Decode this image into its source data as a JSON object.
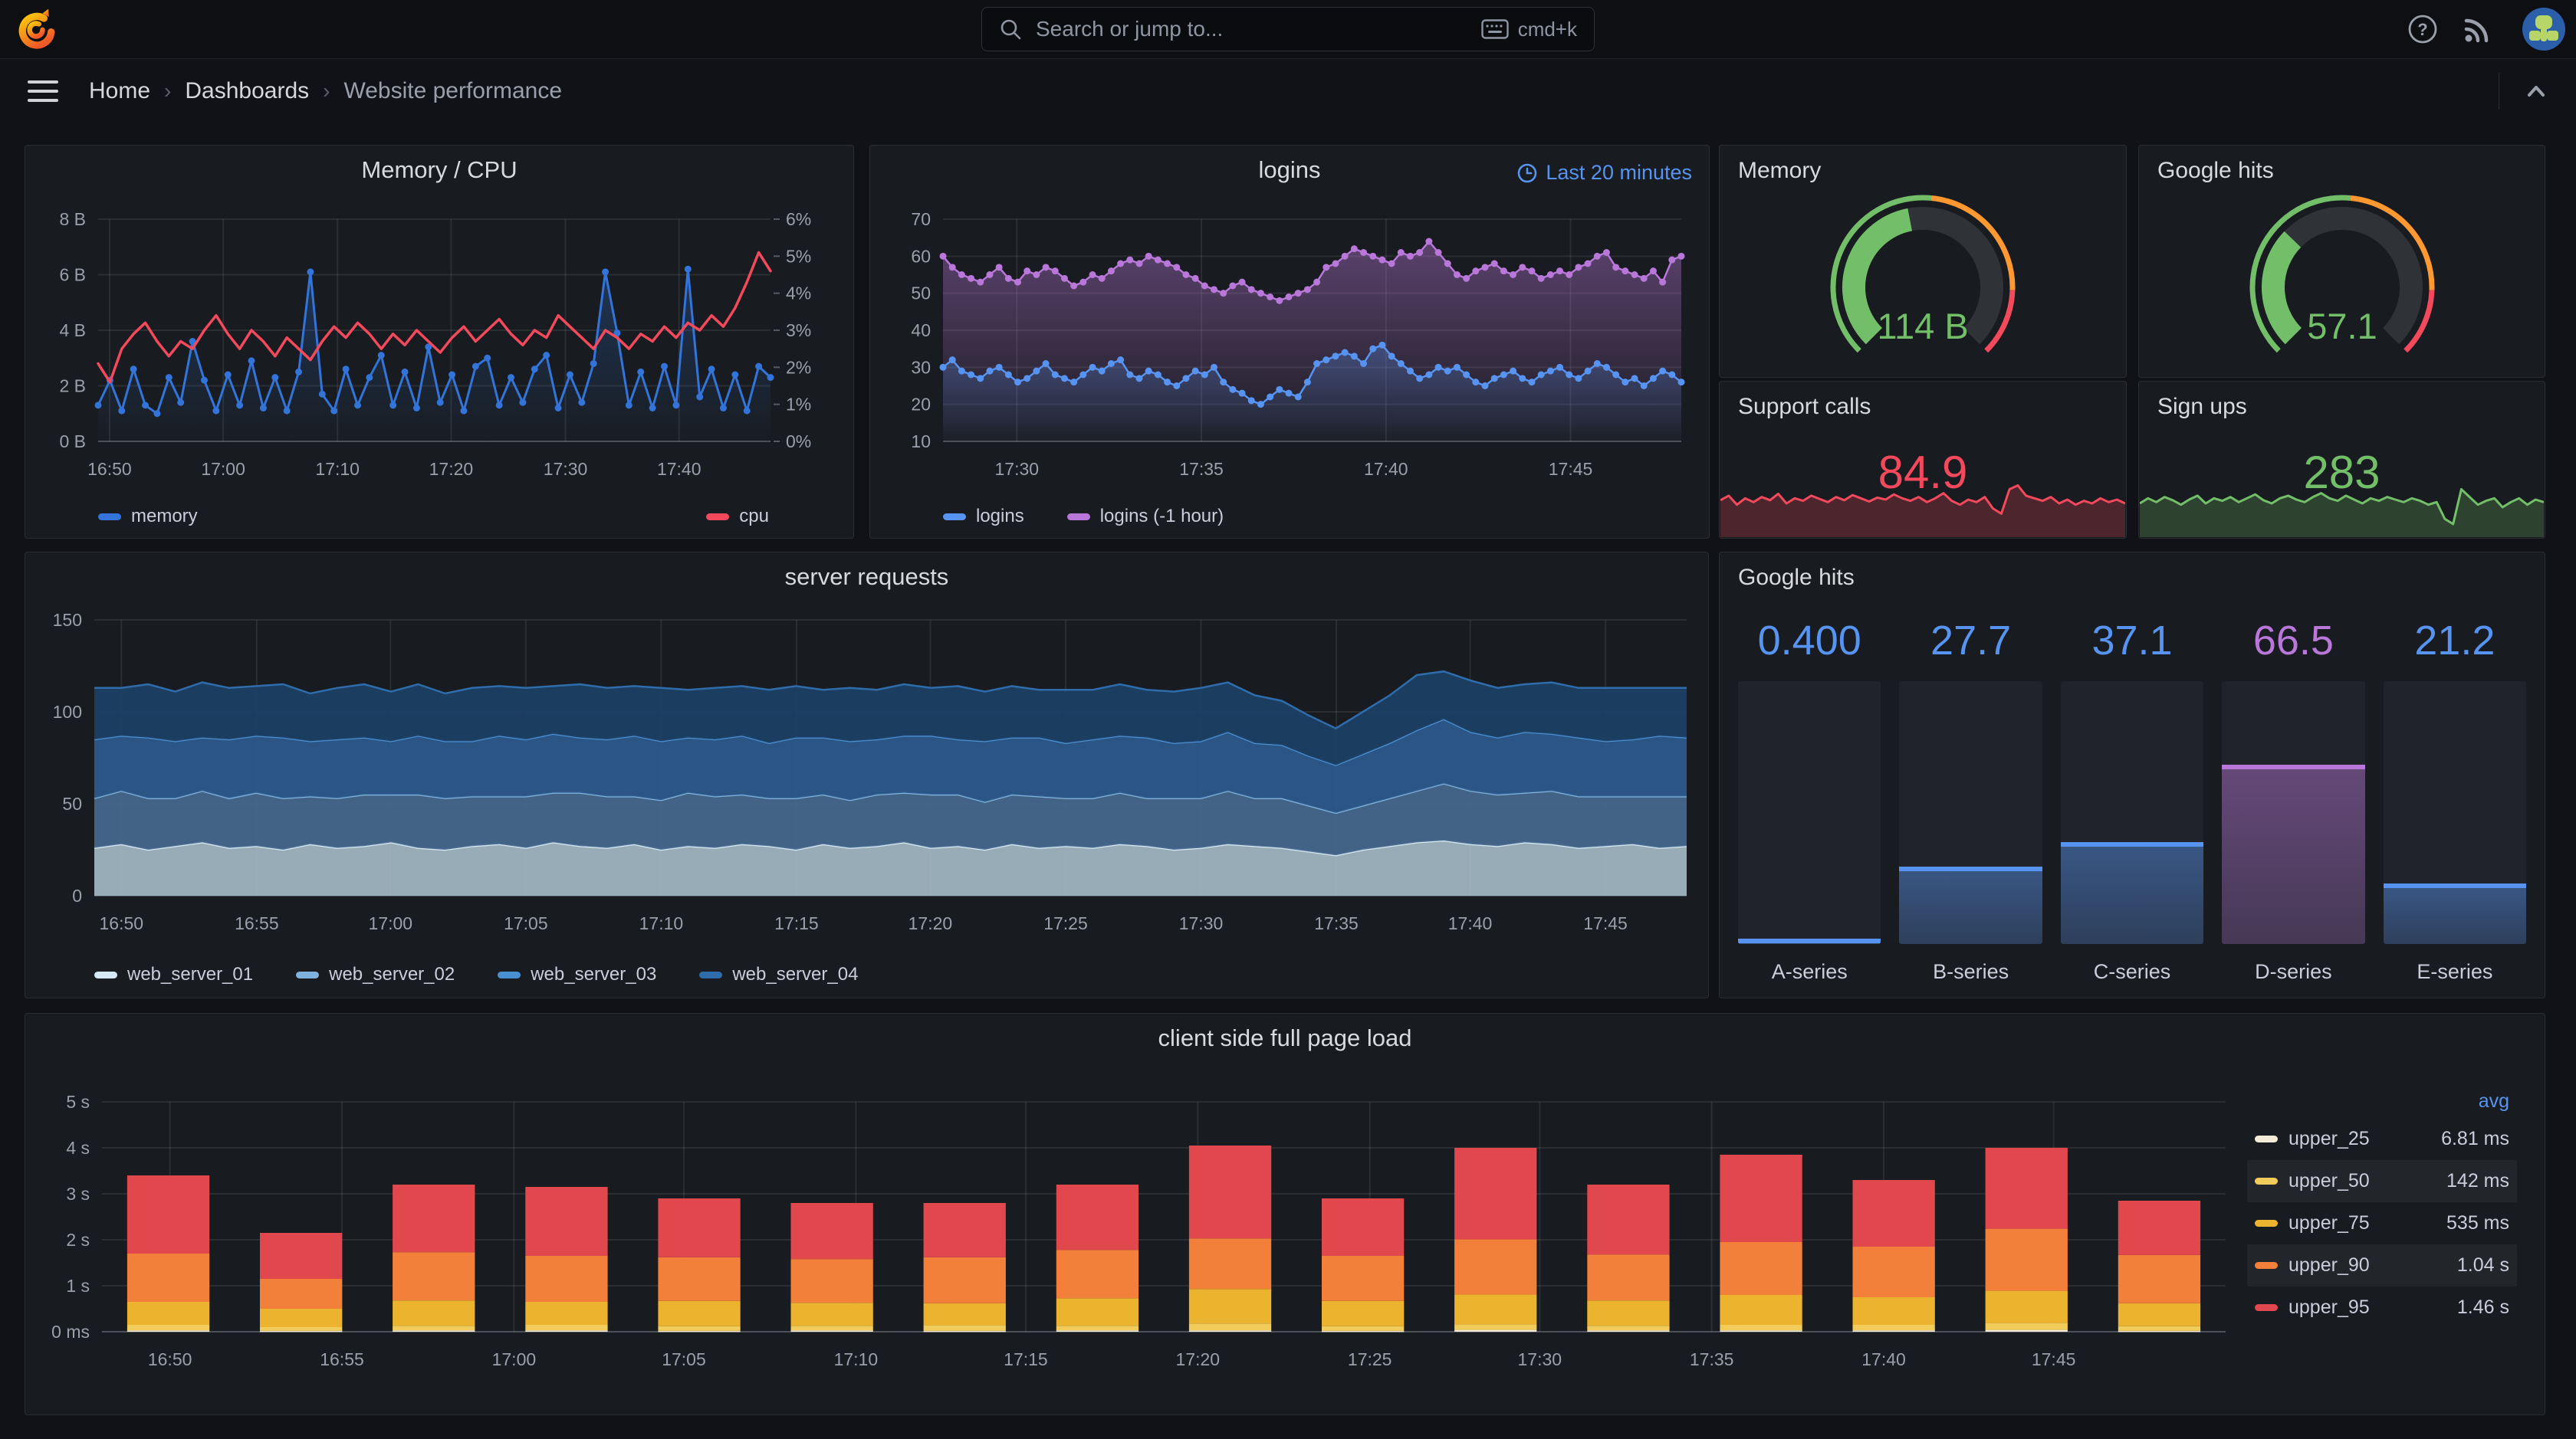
{
  "header": {
    "search_placeholder": "Search or jump to...",
    "search_shortcut": "cmd+k"
  },
  "breadcrumb": {
    "home": "Home",
    "dashboards": "Dashboards",
    "current": "Website performance"
  },
  "icons": {
    "logo": "grafana-logo",
    "search": "magnifier",
    "shortcut": "keyboard",
    "help": "question-circle",
    "news": "rss",
    "profile": "avatar",
    "menu": "hamburger",
    "kiosk": "chevron-up",
    "time": "clock"
  },
  "theme": {
    "background": "#111217",
    "panel": "#181b1f",
    "text": "#ccccdc",
    "blue": "#5794f2"
  },
  "chart_data": [
    {
      "id": "memory_cpu",
      "type": "line",
      "title": "Memory / CPU",
      "x_ticks": [
        {
          "label": "16:50",
          "frac": 0.017
        },
        {
          "label": "17:00",
          "frac": 0.186
        },
        {
          "label": "17:10",
          "frac": 0.356
        },
        {
          "label": "17:20",
          "frac": 0.525
        },
        {
          "label": "17:30",
          "frac": 0.695
        },
        {
          "label": "17:40",
          "frac": 0.864
        }
      ],
      "y_left": {
        "ticks": [
          "0 B",
          "2 B",
          "4 B",
          "6 B",
          "8 B"
        ],
        "min": 0,
        "max": 8
      },
      "y_right": {
        "ticks": [
          "0%",
          "1%",
          "2%",
          "3%",
          "4%",
          "5%",
          "6%"
        ],
        "min": 0,
        "max": 6
      },
      "series": [
        {
          "name": "memory",
          "color": "#3274d9",
          "axis": "left",
          "area": true,
          "points": true,
          "width": 3,
          "values": [
            1.3,
            2.2,
            1.1,
            2.6,
            1.3,
            1.0,
            2.3,
            1.4,
            3.6,
            2.2,
            1.1,
            2.4,
            1.3,
            2.9,
            1.2,
            2.3,
            1.1,
            2.5,
            6.1,
            1.7,
            1.1,
            2.6,
            1.3,
            2.3,
            3.1,
            1.3,
            2.5,
            1.2,
            3.4,
            1.4,
            2.4,
            1.1,
            2.7,
            3.0,
            1.3,
            2.3,
            1.4,
            2.6,
            3.1,
            1.2,
            2.4,
            1.4,
            2.8,
            6.1,
            3.9,
            1.3,
            2.5,
            1.2,
            2.7,
            1.3,
            6.2,
            1.6,
            2.6,
            1.2,
            2.4,
            1.1,
            2.7,
            2.3
          ]
        },
        {
          "name": "cpu",
          "color": "#f2495c",
          "axis": "right",
          "width": 3.5,
          "values": [
            2.1,
            1.6,
            2.5,
            2.9,
            3.2,
            2.7,
            2.3,
            2.7,
            2.5,
            3.0,
            3.4,
            2.9,
            2.5,
            3.0,
            2.7,
            2.3,
            2.8,
            2.5,
            2.2,
            2.7,
            3.1,
            2.8,
            3.2,
            2.9,
            2.5,
            2.9,
            2.6,
            3.0,
            2.7,
            2.4,
            2.8,
            3.1,
            2.7,
            3.0,
            3.3,
            2.9,
            2.6,
            3.0,
            2.8,
            3.4,
            3.1,
            2.8,
            2.5,
            3.0,
            2.8,
            2.5,
            2.9,
            2.7,
            3.1,
            2.8,
            3.2,
            3.0,
            3.4,
            3.1,
            3.6,
            4.3,
            5.1,
            4.6
          ]
        }
      ]
    },
    {
      "id": "logins",
      "type": "line",
      "title": "logins",
      "time_label": "Last 20 minutes",
      "draw_reverse": true,
      "x_ticks": [
        {
          "label": "17:30",
          "frac": 0.1
        },
        {
          "label": "17:35",
          "frac": 0.35
        },
        {
          "label": "17:40",
          "frac": 0.6
        },
        {
          "label": "17:45",
          "frac": 0.85
        }
      ],
      "y_left": {
        "ticks": [
          "10",
          "20",
          "30",
          "40",
          "50",
          "60",
          "70"
        ],
        "min": 10,
        "max": 70
      },
      "series": [
        {
          "name": "logins",
          "color": "#5794f2",
          "axis": "left",
          "area": true,
          "points": true,
          "width": 2.5,
          "area_opacity": 0.3,
          "values": [
            30,
            32,
            29,
            28,
            27,
            29,
            30,
            28,
            26,
            27,
            29,
            31,
            28,
            27,
            26,
            28,
            30,
            29,
            31,
            32,
            28,
            27,
            29,
            28,
            26,
            25,
            27,
            29,
            28,
            30,
            26,
            24,
            23,
            21,
            20,
            22,
            24,
            23,
            22,
            26,
            31,
            32,
            33,
            34,
            33,
            31,
            35,
            36,
            33,
            31,
            29,
            27,
            28,
            30,
            29,
            30,
            28,
            26,
            25,
            27,
            28,
            29,
            27,
            26,
            28,
            29,
            30,
            28,
            27,
            29,
            31,
            30,
            28,
            26,
            27,
            25,
            27,
            29,
            28,
            26
          ]
        },
        {
          "name": "logins (-1 hour)",
          "color": "#b877d9",
          "axis": "left",
          "area": true,
          "points": true,
          "width": 2.5,
          "area_opacity": 0.42,
          "values": [
            60,
            57,
            55,
            54,
            53,
            55,
            57,
            54,
            53,
            56,
            55,
            57,
            56,
            54,
            52,
            53,
            55,
            54,
            56,
            58,
            59,
            58,
            60,
            59,
            58,
            57,
            55,
            54,
            52,
            51,
            50,
            52,
            53,
            51,
            50,
            49,
            48,
            49,
            50,
            51,
            53,
            57,
            58,
            60,
            62,
            61,
            60,
            59,
            58,
            61,
            60,
            61,
            64,
            61,
            58,
            55,
            54,
            56,
            57,
            58,
            56,
            55,
            57,
            56,
            54,
            55,
            56,
            55,
            57,
            58,
            60,
            61,
            57,
            56,
            55,
            54,
            56,
            53,
            59,
            60
          ]
        }
      ]
    },
    {
      "id": "memory_gauge",
      "type": "gauge",
      "title": "Memory",
      "value": "114 B",
      "percent": 0.46,
      "color": "#73bf69",
      "thresholds": [
        {
          "to": 0.52,
          "color": "#73bf69"
        },
        {
          "to": 0.84,
          "color": "#ff9830"
        },
        {
          "to": 1,
          "color": "#f2495c"
        }
      ]
    },
    {
      "id": "google_gauge",
      "type": "gauge",
      "title": "Google hits",
      "value": "57.1",
      "percent": 0.33,
      "color": "#73bf69",
      "thresholds": [
        {
          "to": 0.52,
          "color": "#73bf69"
        },
        {
          "to": 0.84,
          "color": "#ff9830"
        },
        {
          "to": 1,
          "color": "#f2495c"
        }
      ]
    },
    {
      "id": "support_calls",
      "type": "stat",
      "title": "Support calls",
      "value": "84.9",
      "color": "#f2495c",
      "sparkline": [
        55,
        62,
        48,
        58,
        52,
        60,
        55,
        65,
        50,
        58,
        54,
        62,
        57,
        52,
        60,
        55,
        63,
        58,
        53,
        59,
        56,
        64,
        58,
        54,
        60,
        52,
        58,
        66,
        54,
        48,
        56,
        52,
        60,
        42,
        34,
        72,
        78,
        62,
        58,
        54,
        60,
        50,
        56,
        48,
        54,
        50,
        58,
        52,
        56,
        50
      ]
    },
    {
      "id": "sign_ups",
      "type": "stat",
      "title": "Sign ups",
      "value": "283",
      "color": "#73bf69",
      "sparkline": [
        50,
        58,
        52,
        60,
        55,
        48,
        56,
        62,
        50,
        58,
        54,
        60,
        52,
        58,
        64,
        55,
        50,
        58,
        62,
        56,
        52,
        60,
        66,
        58,
        54,
        62,
        56,
        50,
        58,
        54,
        60,
        56,
        52,
        58,
        54,
        48,
        52,
        26,
        18,
        72,
        60,
        48,
        54,
        58,
        44,
        52,
        58,
        48,
        56,
        52
      ]
    },
    {
      "id": "server_requests",
      "type": "stacked-area",
      "title": "server requests",
      "x_ticks": [
        {
          "label": "16:50",
          "frac": 0.017
        },
        {
          "label": "16:55",
          "frac": 0.102
        },
        {
          "label": "17:00",
          "frac": 0.186
        },
        {
          "label": "17:05",
          "frac": 0.271
        },
        {
          "label": "17:10",
          "frac": 0.356
        },
        {
          "label": "17:15",
          "frac": 0.441
        },
        {
          "label": "17:20",
          "frac": 0.525
        },
        {
          "label": "17:25",
          "frac": 0.61
        },
        {
          "label": "17:30",
          "frac": 0.695
        },
        {
          "label": "17:35",
          "frac": 0.78
        },
        {
          "label": "17:40",
          "frac": 0.864
        },
        {
          "label": "17:45",
          "frac": 0.949
        }
      ],
      "y_left": {
        "ticks": [
          "0",
          "50",
          "100",
          "150"
        ],
        "min": 0,
        "max": 150
      },
      "series": [
        {
          "name": "web_server_01",
          "fill": "#a4b9c6",
          "line": "#d7e9f5",
          "values": [
            26,
            28,
            25,
            27,
            29,
            26,
            27,
            25,
            28,
            26,
            27,
            29,
            26,
            25,
            27,
            28,
            26,
            29,
            27,
            26,
            28,
            25,
            27,
            26,
            28,
            27,
            25,
            28,
            26,
            27,
            29,
            26,
            27,
            25,
            28,
            26,
            27,
            26,
            28,
            27,
            25,
            26,
            28,
            27,
            26,
            24,
            22,
            25,
            27,
            29,
            30,
            28,
            27,
            29,
            28,
            26,
            27,
            28,
            26,
            27
          ]
        },
        {
          "name": "web_server_02",
          "fill": "#47698e",
          "line": "#7fb3de",
          "values": [
            27,
            29,
            28,
            26,
            28,
            27,
            29,
            28,
            26,
            27,
            28,
            26,
            29,
            28,
            27,
            26,
            28,
            27,
            29,
            28,
            26,
            27,
            29,
            28,
            27,
            26,
            28,
            27,
            26,
            28,
            27,
            29,
            28,
            26,
            27,
            28,
            26,
            27,
            28,
            26,
            28,
            27,
            29,
            26,
            27,
            25,
            23,
            24,
            26,
            28,
            31,
            29,
            28,
            27,
            29,
            28,
            27,
            26,
            28,
            27
          ]
        },
        {
          "name": "web_server_03",
          "fill": "#2c5a8e",
          "line": "#4a8fd2",
          "values": [
            32,
            30,
            33,
            31,
            29,
            32,
            31,
            33,
            30,
            32,
            31,
            29,
            32,
            31,
            30,
            33,
            31,
            32,
            30,
            31,
            33,
            32,
            30,
            31,
            32,
            30,
            33,
            31,
            32,
            30,
            31,
            32,
            30,
            33,
            31,
            32,
            30,
            32,
            31,
            33,
            30,
            31,
            32,
            30,
            29,
            27,
            26,
            28,
            30,
            33,
            35,
            32,
            31,
            33,
            31,
            32,
            30,
            31,
            33,
            32
          ]
        },
        {
          "name": "web_server_04",
          "fill": "#1c4066",
          "line": "#2e6cab",
          "values": [
            28,
            26,
            29,
            27,
            30,
            28,
            27,
            29,
            26,
            28,
            29,
            27,
            28,
            26,
            29,
            27,
            28,
            26,
            29,
            28,
            27,
            29,
            26,
            28,
            27,
            29,
            28,
            26,
            29,
            27,
            28,
            26,
            29,
            27,
            28,
            26,
            29,
            27,
            28,
            26,
            28,
            29,
            27,
            26,
            24,
            22,
            20,
            23,
            26,
            30,
            26,
            28,
            27,
            26,
            28,
            27,
            29,
            28,
            26,
            27
          ]
        }
      ]
    },
    {
      "id": "google_hits_bars",
      "type": "bar-gauge",
      "title": "Google hits",
      "max": 100,
      "bars": [
        {
          "label": "A-series",
          "value": "0.400",
          "pct": 0.4,
          "color": "#5794f2"
        },
        {
          "label": "B-series",
          "value": "27.7",
          "pct": 27.7,
          "color": "#5794f2"
        },
        {
          "label": "C-series",
          "value": "37.1",
          "pct": 37.1,
          "color": "#5794f2"
        },
        {
          "label": "D-series",
          "value": "66.5",
          "pct": 66.5,
          "color": "#b877d9"
        },
        {
          "label": "E-series",
          "value": "21.2",
          "pct": 21.2,
          "color": "#5794f2"
        }
      ]
    },
    {
      "id": "client_load",
      "type": "stacked-bars",
      "title": "client side full page load",
      "max": 5,
      "y_ticks": [
        "0 ms",
        "1 s",
        "2 s",
        "3 s",
        "4 s",
        "5 s"
      ],
      "x_ticks": [
        {
          "label": "16:50",
          "frac": 0.032
        },
        {
          "label": "16:55",
          "frac": 0.113
        },
        {
          "label": "17:00",
          "frac": 0.194
        },
        {
          "label": "17:05",
          "frac": 0.274
        },
        {
          "label": "17:10",
          "frac": 0.355
        },
        {
          "label": "17:15",
          "frac": 0.435
        },
        {
          "label": "17:20",
          "frac": 0.516
        },
        {
          "label": "17:25",
          "frac": 0.597
        },
        {
          "label": "17:30",
          "frac": 0.677
        },
        {
          "label": "17:35",
          "frac": 0.758
        },
        {
          "label": "17:40",
          "frac": 0.839
        },
        {
          "label": "17:45",
          "frac": 0.919
        }
      ],
      "series_names": [
        "upper_25",
        "upper_50",
        "upper_75",
        "upper_90",
        "upper_95"
      ],
      "colors": [
        "#f4ead8",
        "#f2cc5a",
        "#ecb32f",
        "#f2803a",
        "#e0484e"
      ],
      "bars": [
        [
          0.03,
          0.12,
          0.5,
          1.05,
          1.7
        ],
        [
          0.02,
          0.08,
          0.4,
          0.65,
          1.0
        ],
        [
          0.03,
          0.1,
          0.55,
          1.05,
          1.47
        ],
        [
          0.03,
          0.12,
          0.5,
          1.0,
          1.5
        ],
        [
          0.02,
          0.1,
          0.55,
          0.95,
          1.28
        ],
        [
          0.03,
          0.1,
          0.5,
          0.95,
          1.22
        ],
        [
          0.02,
          0.12,
          0.48,
          1.0,
          1.18
        ],
        [
          0.03,
          0.1,
          0.6,
          1.05,
          1.42
        ],
        [
          0.03,
          0.15,
          0.75,
          1.1,
          2.02
        ],
        [
          0.02,
          0.1,
          0.55,
          0.98,
          1.25
        ],
        [
          0.04,
          0.12,
          0.65,
          1.2,
          1.99
        ],
        [
          0.03,
          0.1,
          0.55,
          1.0,
          1.52
        ],
        [
          0.03,
          0.12,
          0.65,
          1.15,
          1.9
        ],
        [
          0.03,
          0.12,
          0.6,
          1.1,
          1.45
        ],
        [
          0.04,
          0.15,
          0.7,
          1.35,
          1.76
        ],
        [
          0.02,
          0.1,
          0.5,
          1.05,
          1.18
        ]
      ],
      "legend": {
        "header": "avg",
        "rows": [
          {
            "name": "upper_25",
            "value": "6.81 ms"
          },
          {
            "name": "upper_50",
            "value": "142 ms"
          },
          {
            "name": "upper_75",
            "value": "535 ms"
          },
          {
            "name": "upper_90",
            "value": "1.04 s"
          },
          {
            "name": "upper_95",
            "value": "1.46 s"
          }
        ]
      }
    }
  ]
}
